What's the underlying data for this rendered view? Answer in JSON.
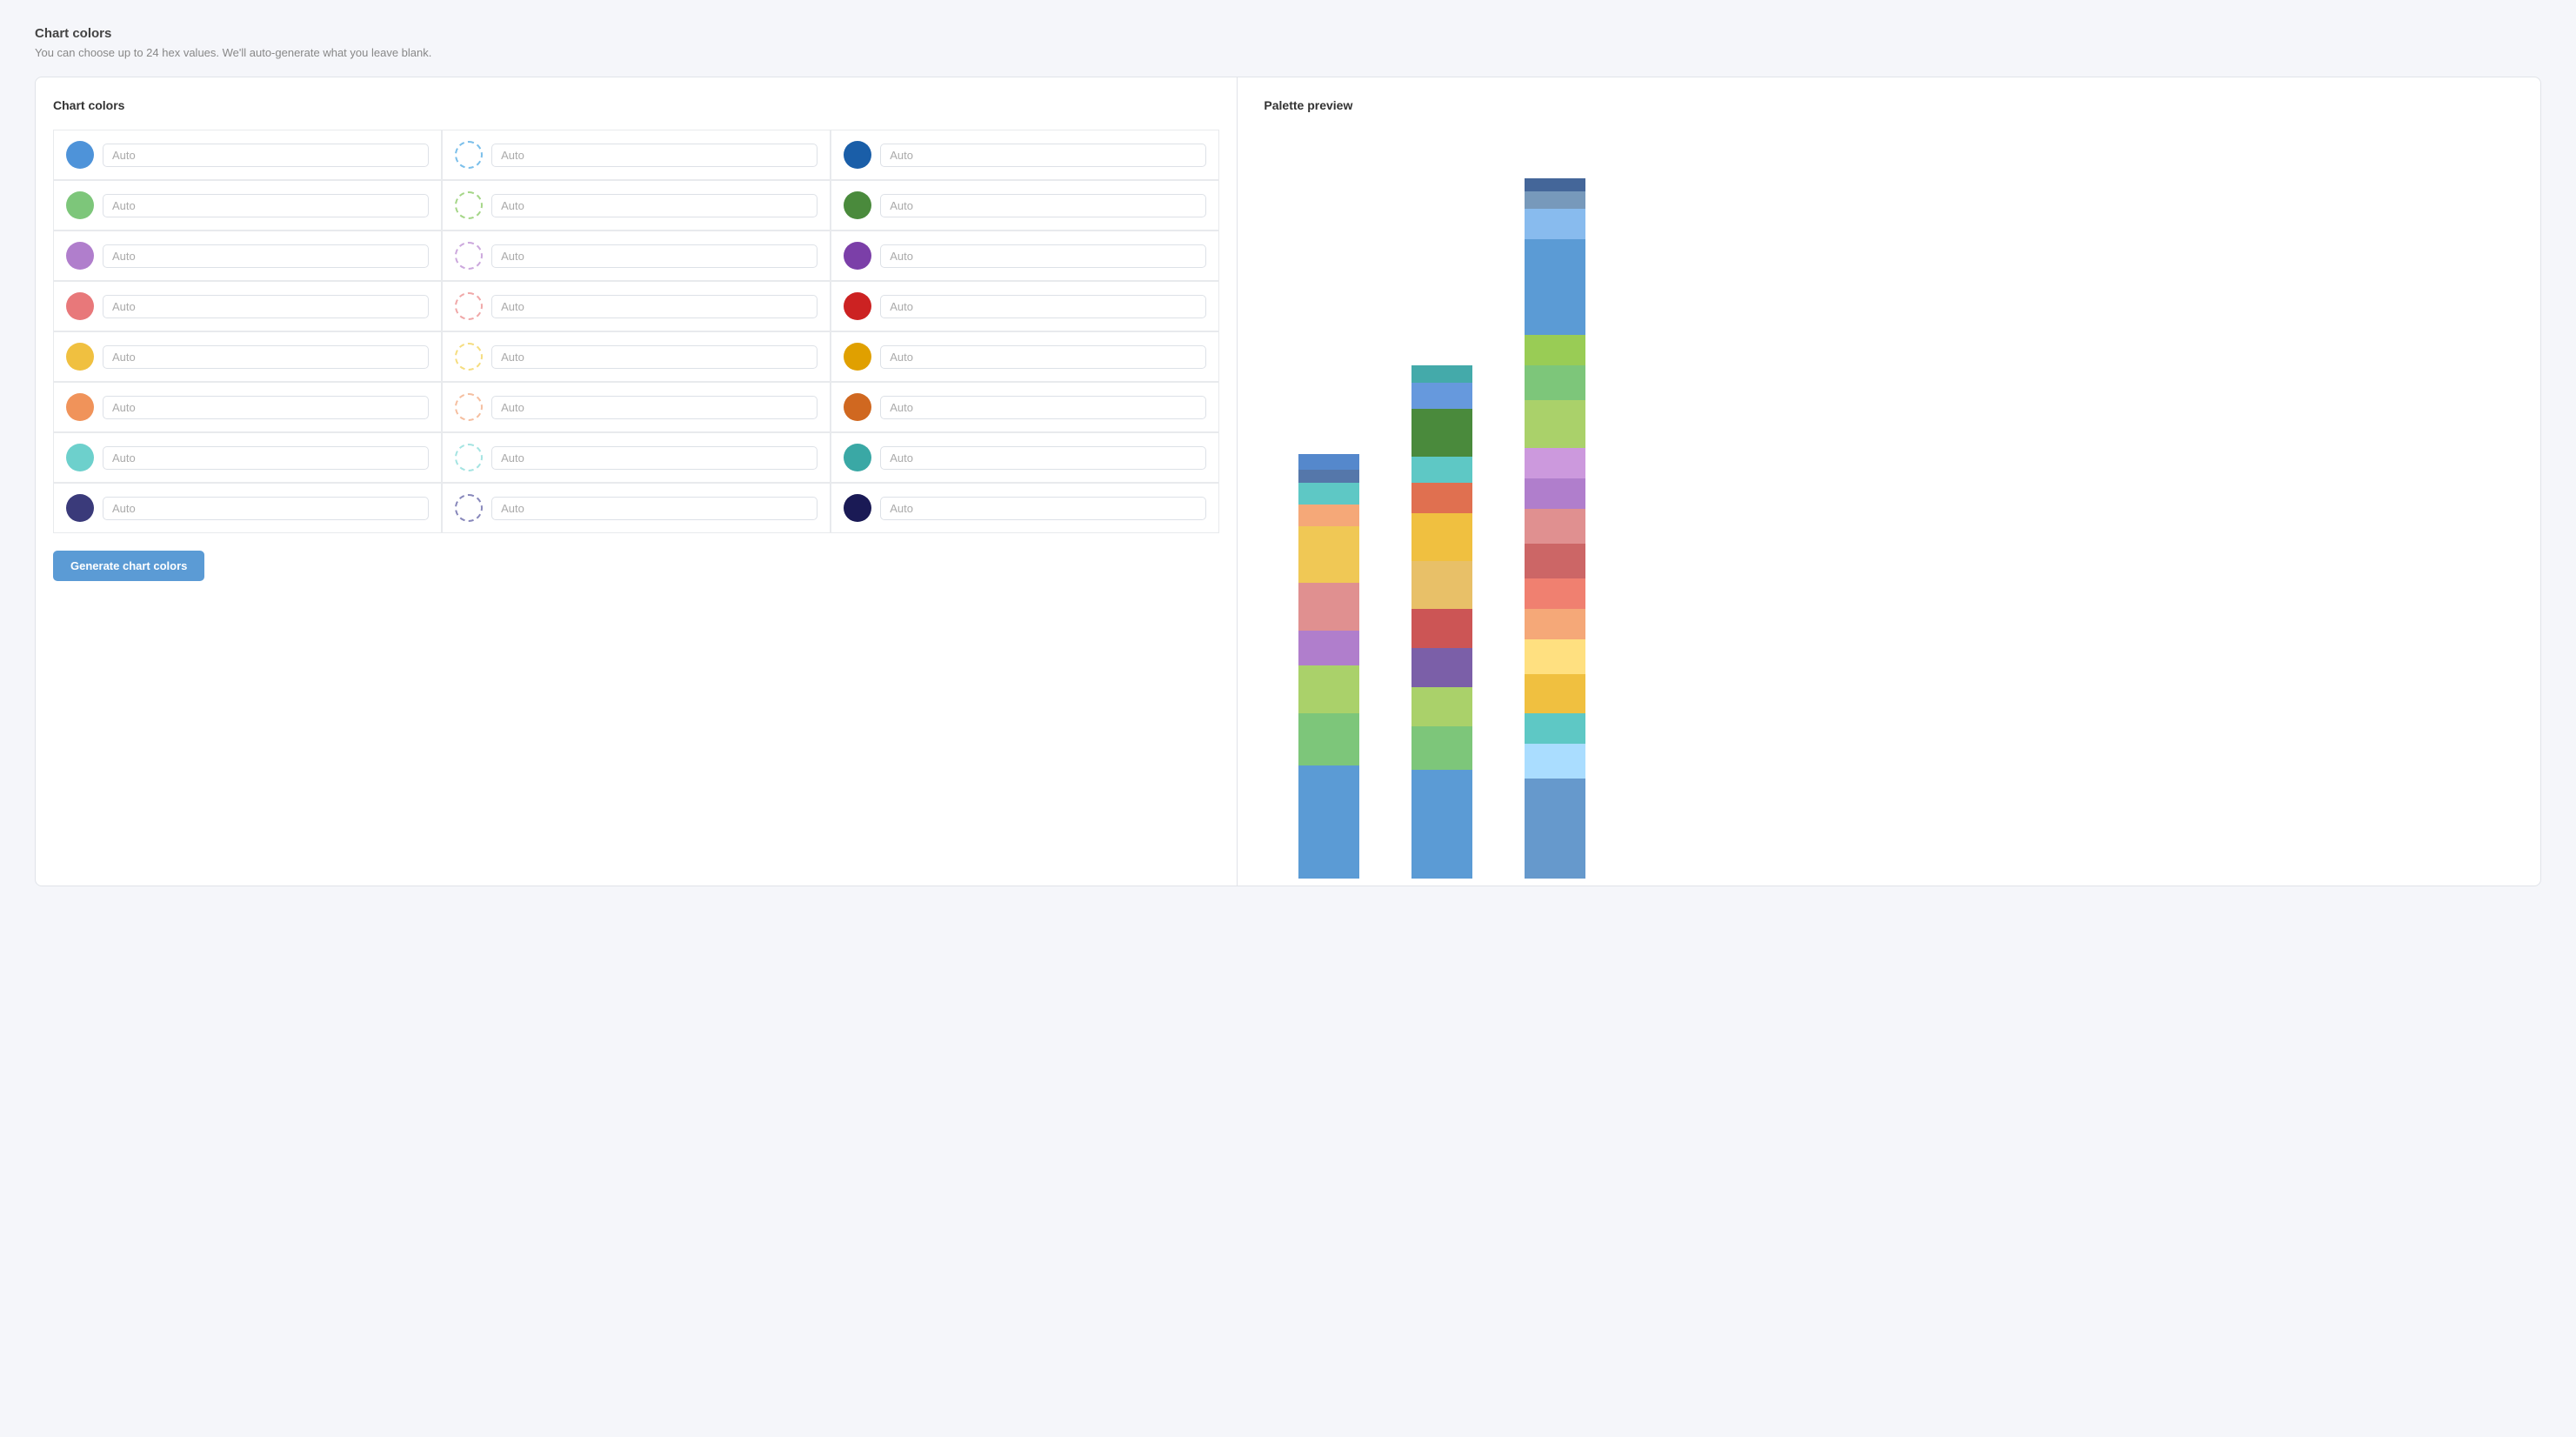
{
  "page": {
    "title": "Chart colors",
    "subtitle": "You can choose up to 24 hex values. We'll auto-generate what you leave blank."
  },
  "left_panel": {
    "title": "Chart colors",
    "generate_button": "Generate chart colors"
  },
  "right_panel": {
    "title": "Palette preview"
  },
  "color_rows": [
    {
      "cols": [
        {
          "bg": "#4e93d9",
          "style": "solid",
          "value": "Auto"
        },
        {
          "bg": "#7bbfea",
          "style": "dashed",
          "value": "Auto"
        },
        {
          "bg": "#1a5ea8",
          "style": "solid",
          "value": "Auto"
        }
      ]
    },
    {
      "cols": [
        {
          "bg": "#7dc67a",
          "style": "solid",
          "value": "Auto"
        },
        {
          "bg": "#a5d688",
          "style": "dashed",
          "value": "Auto"
        },
        {
          "bg": "#4a8a3c",
          "style": "solid",
          "value": "Auto"
        }
      ]
    },
    {
      "cols": [
        {
          "bg": "#b07ecc",
          "style": "solid",
          "value": "Auto"
        },
        {
          "bg": "#cca8dd",
          "style": "dashed",
          "value": "Auto"
        },
        {
          "bg": "#7b3fa8",
          "style": "solid",
          "value": "Auto"
        }
      ]
    },
    {
      "cols": [
        {
          "bg": "#e8787a",
          "style": "solid",
          "value": "Auto"
        },
        {
          "bg": "#f0a8a8",
          "style": "dashed",
          "value": "Auto"
        },
        {
          "bg": "#cc2222",
          "style": "solid",
          "value": "Auto"
        }
      ]
    },
    {
      "cols": [
        {
          "bg": "#f0c040",
          "style": "solid",
          "value": "Auto"
        },
        {
          "bg": "#f5dd80",
          "style": "dashed",
          "value": "Auto"
        },
        {
          "bg": "#e0a000",
          "style": "solid",
          "value": "Auto"
        }
      ]
    },
    {
      "cols": [
        {
          "bg": "#f0935a",
          "style": "solid",
          "value": "Auto"
        },
        {
          "bg": "#f5bfa0",
          "style": "dashed",
          "value": "Auto"
        },
        {
          "bg": "#d06820",
          "style": "solid",
          "value": "Auto"
        }
      ]
    },
    {
      "cols": [
        {
          "bg": "#6dd0cc",
          "style": "solid",
          "value": "Auto"
        },
        {
          "bg": "#a5e4e2",
          "style": "dashed",
          "value": "Auto"
        },
        {
          "bg": "#3aa8a5",
          "style": "solid",
          "value": "Auto"
        }
      ]
    },
    {
      "cols": [
        {
          "bg": "#3a3a7a",
          "style": "solid",
          "value": "Auto"
        },
        {
          "bg": "#8888bb",
          "style": "dashed",
          "value": "Auto"
        },
        {
          "bg": "#1a1a55",
          "style": "solid",
          "value": "Auto"
        }
      ]
    }
  ],
  "chart": {
    "bars": [
      {
        "segments": [
          {
            "color": "#5b9bd5",
            "height": 130
          },
          {
            "color": "#7dc67a",
            "height": 60
          },
          {
            "color": "#aad16a",
            "height": 55
          },
          {
            "color": "#b07ecc",
            "height": 40
          },
          {
            "color": "#e09090",
            "height": 55
          },
          {
            "color": "#f0c855",
            "height": 65
          },
          {
            "color": "#f5a878",
            "height": 25
          },
          {
            "color": "#5ec8c5",
            "height": 25
          },
          {
            "color": "#5577aa",
            "height": 15
          },
          {
            "color": "#5588cc",
            "height": 18
          }
        ]
      },
      {
        "segments": [
          {
            "color": "#5b9bd5",
            "height": 125
          },
          {
            "color": "#7dc67a",
            "height": 50
          },
          {
            "color": "#aad16a",
            "height": 45
          },
          {
            "color": "#7b5fa8",
            "height": 45
          },
          {
            "color": "#cc5555",
            "height": 45
          },
          {
            "color": "#e8c068",
            "height": 55
          },
          {
            "color": "#f0c040",
            "height": 55
          },
          {
            "color": "#e07050",
            "height": 35
          },
          {
            "color": "#5ec8c5",
            "height": 30
          },
          {
            "color": "#4a8a3c",
            "height": 55
          },
          {
            "color": "#6699dd",
            "height": 30
          },
          {
            "color": "#44aaaa",
            "height": 20
          }
        ]
      },
      {
        "segments": [
          {
            "color": "#6699cc",
            "height": 115
          },
          {
            "color": "#aaddff",
            "height": 40
          },
          {
            "color": "#5ec8c5",
            "height": 35
          },
          {
            "color": "#f0c040",
            "height": 45
          },
          {
            "color": "#ffe080",
            "height": 40
          },
          {
            "color": "#f5a878",
            "height": 35
          },
          {
            "color": "#f08070",
            "height": 35
          },
          {
            "color": "#cc6666",
            "height": 40
          },
          {
            "color": "#e09090",
            "height": 40
          },
          {
            "color": "#b07ecc",
            "height": 35
          },
          {
            "color": "#cc99dd",
            "height": 35
          },
          {
            "color": "#aad16a",
            "height": 55
          },
          {
            "color": "#7dc67a",
            "height": 40
          },
          {
            "color": "#99cc55",
            "height": 35
          },
          {
            "color": "#5b9bd5",
            "height": 110
          },
          {
            "color": "#88bbee",
            "height": 35
          },
          {
            "color": "#7799bb",
            "height": 20
          },
          {
            "color": "#446699",
            "height": 15
          }
        ]
      }
    ]
  }
}
